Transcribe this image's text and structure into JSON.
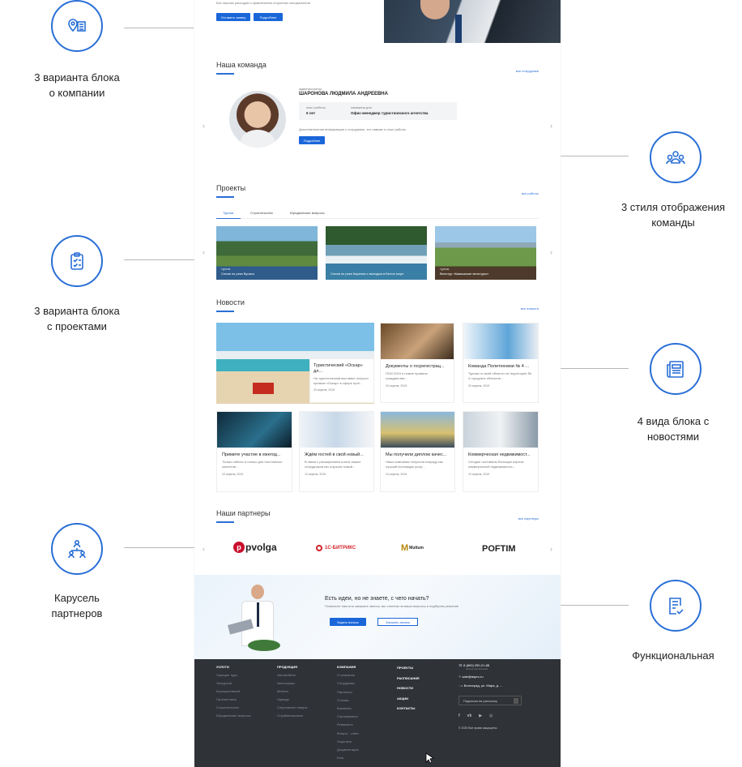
{
  "annotations": {
    "about_l1": "3 варианта блока",
    "about_l2": "о компании",
    "team_l1": "3 стиля отображения",
    "team_l2": "команды",
    "projects_l1": "3 варианта блока",
    "projects_l2": "с проектами",
    "news_l1": "4 вида блока с",
    "news_l2": "новостями",
    "partners_l1": "Карусель",
    "partners_l2": "партнеров",
    "functional": "Функциональная"
  },
  "hero": {
    "subtitle": "Без лишних расходов и привлечения сторонних специалистов",
    "btn_order": "Оставить заявку",
    "btn_more": "Подробнее"
  },
  "team": {
    "title": "Наша команда",
    "all": "все сотрудники",
    "role": "администратор",
    "name": "ШАРОНОВА ЛЮДМИЛА АНДРЕЕВНА",
    "exp_label": "опыт работы",
    "exp_value": "5 лет",
    "pos_label": "компания для",
    "pos_value": "Офис-менеджер туристического агентства",
    "desc": "Дополнительная информация о сотруднике, его навыки и опыт работы",
    "btn": "Подробнее"
  },
  "projects": {
    "title": "Проекты",
    "all": "все работы",
    "tabs": [
      "Туризм",
      "Строительство",
      "Юридические вопросы"
    ],
    "cards": [
      {
        "tag": "туризм",
        "caption": "Сплав по реке Вуокса"
      },
      {
        "tag": "",
        "caption": "Сплав по реке Карелия с выездом в Белое море"
      },
      {
        "tag": "туризм",
        "caption": "Велотур «Кавказские велотуры»"
      }
    ]
  },
  "news": {
    "title": "Новости",
    "all": "все новости",
    "items": [
      {
        "title": "Туристический «Оскар» дл...",
        "text": "На туристический выставке получил премию «Оскар» в сфере путе...",
        "date": "20 апреля, 2019"
      },
      {
        "title": "Документы о госрегистрац...",
        "text": "ПОИ 2019 и новые правила гражданства...",
        "date": "20 апреля, 2019"
      },
      {
        "title": "Команда Политехники № 4 ...",
        "text": "Туризм по всей области на территории № 4 городских объектов...",
        "date": "20 апреля, 2019"
      },
      {
        "title": "Примите участие в ежегод...",
        "text": "Только сейчас и только для постоянных клиентов...",
        "date": "10 апреля, 2019"
      },
      {
        "title": "Ждём гостей в свой новый...",
        "text": "В связи с расширением штата наших сотрудников мы открыли новый...",
        "date": "10 апреля, 2019"
      },
      {
        "title": "Мы получили диплом качес...",
        "text": "Наша компания получила награду как лучший поставщик услуг...",
        "date": "10 апреля, 2019"
      },
      {
        "title": "Коммерческая недвижимост...",
        "text": "Сегодня поставили большую партию коммерческой недвижимости...",
        "date": "10 апреля, 2019"
      }
    ]
  },
  "partners": {
    "title": "Наши партнеры",
    "all": "все партнеры",
    "logos": [
      "pvolga",
      "1С-БИТРИКС",
      "Multum",
      "POFTIM"
    ]
  },
  "cta": {
    "title": "Есть идеи, но не знаете, с чего начать?",
    "text": "Позвоните нам или закажите звонок, мы ответим на ваши вопросы и подберем решение",
    "btn_ask": "Задать вопрос",
    "btn_call": "Заказать звонок"
  },
  "footer": {
    "cols": [
      {
        "head": "УСЛУГИ",
        "items": [
          "Горящие туры",
          "Экскурсии",
          "Корпоративный",
          "Путешествия",
          "Строительство",
          "Юридические вопросы"
        ]
      },
      {
        "head": "ПРОДУКЦИЯ",
        "items": [
          "Автомобили",
          "Аксессуары",
          "Мебель",
          "Одежда",
          "Спортивные товары",
          "Стройматериалы"
        ]
      },
      {
        "head": "КОМПАНИЯ",
        "items": [
          "О компании",
          "Сотрудники",
          "Партнеры",
          "Отзывы",
          "Вакансии",
          "Сертификаты",
          "Реквизиты",
          "Вопрос - ответ",
          "Лицензии",
          "Документация",
          "Блог"
        ]
      }
    ],
    "links": [
      "ПРОЕКТЫ",
      "РАСПИСАНИЕ",
      "НОВОСТИ",
      "АКЦИИ",
      "КОНТАКТЫ"
    ],
    "phone": "8 (800) 250-21-88",
    "phone_note": "звонок бесплатный",
    "email": "sale@aspro.ru",
    "address": "г. Волгоград, ул. Мира, д. ...",
    "subscribe": "Подписка на рассылку",
    "copyright": "© 2020 Все права защищены"
  }
}
